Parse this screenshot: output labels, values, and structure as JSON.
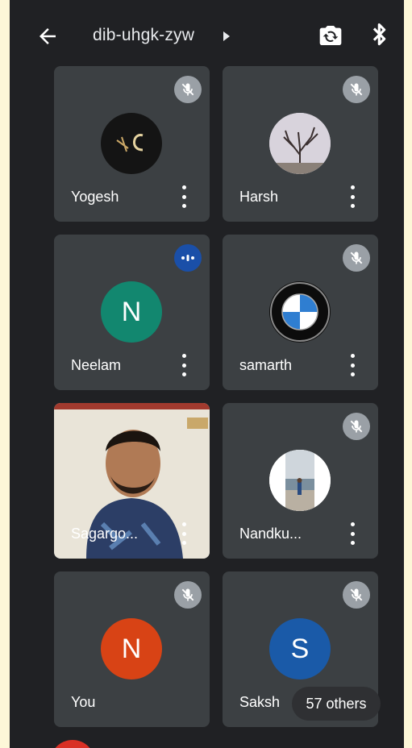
{
  "header": {
    "meeting_code": "dib-uhgk-zyw",
    "back_icon": "arrow-back-icon",
    "switch_camera_icon": "camera-switch-icon",
    "bluetooth_icon": "bluetooth-icon"
  },
  "participants": [
    {
      "name": "Yogesh",
      "avatar_type": "image-logo",
      "muted": true
    },
    {
      "name": "Harsh",
      "avatar_type": "image-tree",
      "muted": true
    },
    {
      "name": "Neelam",
      "initial": "N",
      "avatar_color": "#12876f",
      "speaking": true
    },
    {
      "name": "samarth",
      "avatar_type": "image-bmw-logo",
      "muted": true
    },
    {
      "name": "Sagargo...",
      "avatar_type": "video-feed",
      "muted": false
    },
    {
      "name": "Nandku...",
      "avatar_type": "image-beach",
      "muted": true
    },
    {
      "name": "You",
      "initial": "N",
      "avatar_color": "#d84315",
      "muted": true
    },
    {
      "name": "Saksh",
      "initial": "S",
      "avatar_color": "#1a5aa8",
      "muted": true
    }
  ],
  "overflow": {
    "label": "57 others"
  },
  "colors": {
    "background": "#202124",
    "tile": "#3c4043",
    "mute_badge": "#9aa0a6",
    "speaking_badge": "#1a4fa8"
  }
}
